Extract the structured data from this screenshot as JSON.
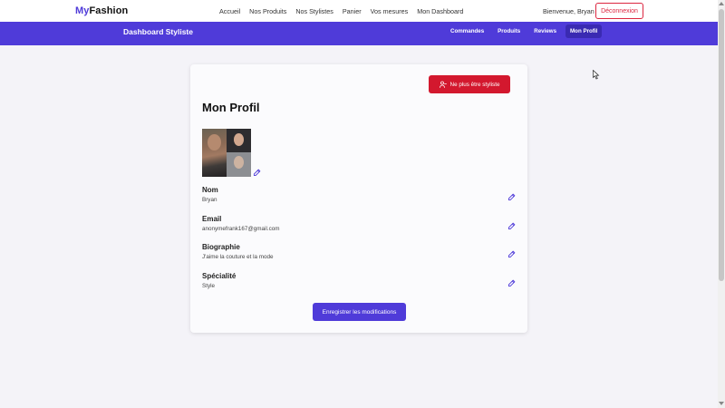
{
  "nav": {
    "logo_part1": "My",
    "logo_part2": "Fashion",
    "links": [
      "Accueil",
      "Nos Produits",
      "Nos Stylistes",
      "Panier",
      "Vos mesures",
      "Mon Dashboard"
    ],
    "welcome": "Bienvenue, Bryan",
    "logout": "Déconnexion"
  },
  "dashbar": {
    "title": "Dashboard Styliste",
    "tabs": [
      "Commandes",
      "Produits",
      "Reviews",
      "Mon Profil"
    ],
    "active_tab": "Mon Profil"
  },
  "profile": {
    "stop_button": "Ne plus être styliste",
    "title": "Mon Profil",
    "fields": [
      {
        "label": "Nom",
        "value": "Bryan"
      },
      {
        "label": "Email",
        "value": "anonymefrank167@gmail.com"
      },
      {
        "label": "Biographie",
        "value": "J'aime la couture et la mode"
      },
      {
        "label": "Spécialité",
        "value": "Style"
      }
    ],
    "save_button": "Enregistrer les modifications"
  },
  "colors": {
    "primary": "#4f3bd9",
    "danger": "#d3182e",
    "background": "#f4f3f8"
  },
  "icons": {
    "edit": "pencil-icon",
    "stop": "user-minus-icon"
  }
}
